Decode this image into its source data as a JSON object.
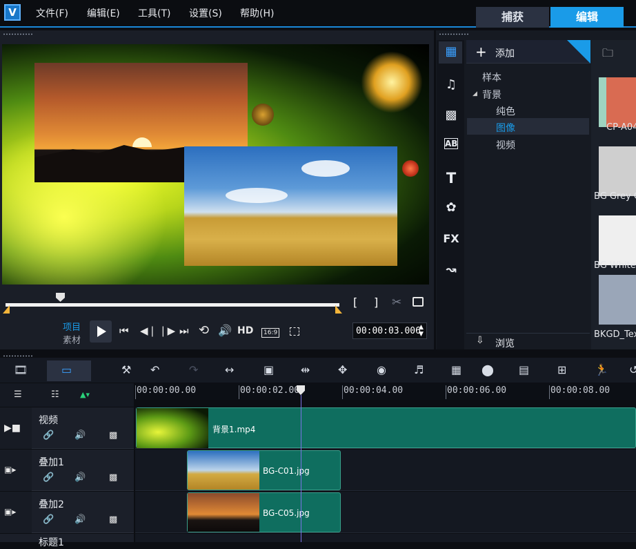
{
  "menu": {
    "items": [
      "文件(F)",
      "编辑(E)",
      "工具(T)",
      "设置(S)",
      "帮助(H)"
    ],
    "mode_tabs": [
      "捕获",
      "编辑"
    ]
  },
  "colors": {
    "accent": "#1a9be8",
    "clip": "#0f6e5f",
    "playhead": "#7b74e6"
  },
  "player": {
    "mode_project": "项目",
    "mode_clip": "素材",
    "hd": "HD",
    "aspect": "16:9",
    "timecode": "00:00:03.006",
    "trim_in": "[",
    "trim_out": "]"
  },
  "library": {
    "add_label": "添加",
    "tree": [
      {
        "label": "样本"
      },
      {
        "label": "背景"
      },
      {
        "label": "纯色"
      },
      {
        "label": "图像"
      },
      {
        "label": "视频"
      }
    ],
    "browse_label": "浏览",
    "side_icons": [
      "media-icon",
      "audio-icon",
      "instant-project-icon",
      "transition-icon",
      "title-icon",
      "graphic-icon",
      "filter-icon",
      "path-icon"
    ],
    "side_icon_text": {
      "transition": "AB",
      "title": "T",
      "filter": "FX"
    },
    "thumbnails": [
      {
        "label": "CP-A04",
        "color": "#d96b52"
      },
      {
        "label": "BG Grey C",
        "color": "#cfcfcf"
      },
      {
        "label": "BG White",
        "color": "#efefef"
      },
      {
        "label": "BKGD_Tex",
        "color": "#9aa6b8"
      }
    ]
  },
  "timeline": {
    "ruler_ticks": [
      "00:00:00.00",
      "00:00:02.00",
      "00:00:04.00",
      "00:00:06.00",
      "00:00:08.00"
    ],
    "tracks": [
      {
        "name": "视频",
        "clip": "背景1.mp4"
      },
      {
        "name": "叠加1",
        "clip": "BG-C01.jpg"
      },
      {
        "name": "叠加2",
        "clip": "BG-C05.jpg"
      },
      {
        "name": "标题1",
        "clip": ""
      }
    ]
  }
}
